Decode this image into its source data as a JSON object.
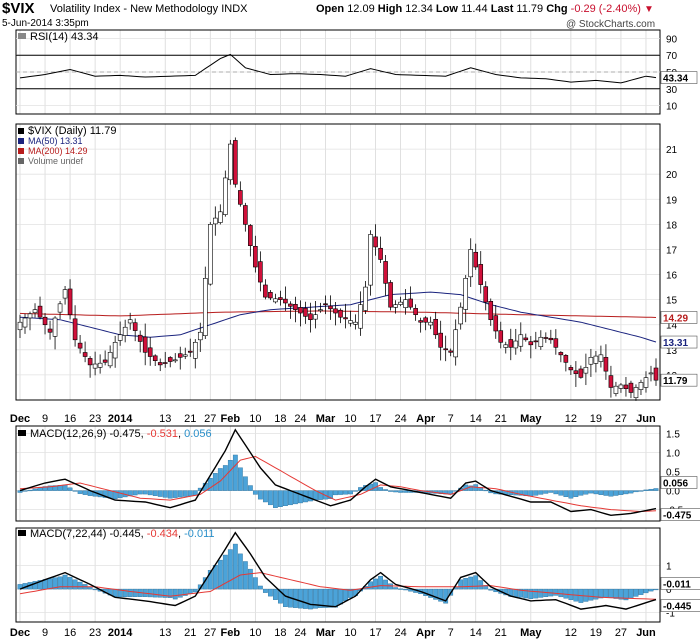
{
  "header": {
    "symbol": "$VIX",
    "name": "Volatility Index - New Methodology",
    "exchange": "INDX",
    "date": "5-Jun-2014 3:35pm",
    "open_label": "Open",
    "open": "12.09",
    "high_label": "High",
    "high": "12.34",
    "low_label": "Low",
    "low": "11.44",
    "last_label": "Last",
    "last": "11.79",
    "chg_label": "Chg",
    "chg": "-0.29 (-2.40%)",
    "watermark": "@ StockCharts.com"
  },
  "colors": {
    "up": "#ffffff",
    "down": "#d0103a",
    "ma50": "#1a237e",
    "ma200": "#b71c1c",
    "hist": "#4ba3d9",
    "signal": "#e53935"
  },
  "x_axis": {
    "labels": [
      {
        "text": "Dec",
        "i": 0,
        "bold": true
      },
      {
        "text": "9",
        "i": 5
      },
      {
        "text": "16",
        "i": 10
      },
      {
        "text": "23",
        "i": 15
      },
      {
        "text": "2014",
        "i": 20,
        "bold": true
      },
      {
        "text": "13",
        "i": 29
      },
      {
        "text": "21",
        "i": 34
      },
      {
        "text": "27",
        "i": 38
      },
      {
        "text": "Feb",
        "i": 42,
        "bold": true
      },
      {
        "text": "10",
        "i": 47
      },
      {
        "text": "18",
        "i": 52
      },
      {
        "text": "24",
        "i": 56
      },
      {
        "text": "Mar",
        "i": 61,
        "bold": true
      },
      {
        "text": "10",
        "i": 66
      },
      {
        "text": "17",
        "i": 71
      },
      {
        "text": "24",
        "i": 76
      },
      {
        "text": "Apr",
        "i": 81,
        "bold": true
      },
      {
        "text": "7",
        "i": 86
      },
      {
        "text": "14",
        "i": 91
      },
      {
        "text": "21",
        "i": 96
      },
      {
        "text": "May",
        "i": 102,
        "bold": true
      },
      {
        "text": "12",
        "i": 110
      },
      {
        "text": "19",
        "i": 115
      },
      {
        "text": "27",
        "i": 120
      },
      {
        "text": "Jun",
        "i": 125,
        "bold": true
      }
    ]
  },
  "rsi": {
    "legend": "RSI(14) 43.34",
    "last": "43.34",
    "ticks": [
      "90",
      "70",
      "50",
      "30",
      "10"
    ],
    "guides": [
      70,
      30
    ],
    "anchors": [
      [
        0,
        43
      ],
      [
        5,
        47
      ],
      [
        10,
        53
      ],
      [
        15,
        45
      ],
      [
        20,
        46
      ],
      [
        25,
        44
      ],
      [
        30,
        45
      ],
      [
        35,
        46
      ],
      [
        38,
        58
      ],
      [
        40,
        66
      ],
      [
        42,
        71
      ],
      [
        45,
        55
      ],
      [
        50,
        47
      ],
      [
        55,
        48
      ],
      [
        60,
        47
      ],
      [
        65,
        45
      ],
      [
        70,
        54
      ],
      [
        75,
        47
      ],
      [
        80,
        46
      ],
      [
        85,
        45
      ],
      [
        90,
        55
      ],
      [
        95,
        47
      ],
      [
        100,
        43
      ],
      [
        105,
        42
      ],
      [
        110,
        38
      ],
      [
        115,
        40
      ],
      [
        120,
        37
      ],
      [
        125,
        45
      ],
      [
        127,
        43.34
      ]
    ]
  },
  "chart_data": [
    {
      "type": "candlestick",
      "title": "$VIX (Daily) 11.79",
      "legend": [
        "$VIX (Daily) 11.79",
        "MA(50) 13.31",
        "MA(200) 14.29",
        "Volume undef"
      ],
      "ylim": [
        11,
        22
      ],
      "ticks": [
        "21",
        "20",
        "19",
        "18",
        "17",
        "16",
        "15",
        "14",
        "13",
        "12"
      ],
      "last_label": "11.79",
      "ma50_label": "13.31",
      "ma200_label": "14.29",
      "price_anchors": [
        [
          0,
          14.1
        ],
        [
          3,
          14.6
        ],
        [
          6,
          13.7
        ],
        [
          9,
          15.4
        ],
        [
          11,
          13.4
        ],
        [
          14,
          12.4
        ],
        [
          17,
          12.5
        ],
        [
          19,
          13.3
        ],
        [
          22,
          14.2
        ],
        [
          25,
          12.9
        ],
        [
          28,
          12.4
        ],
        [
          31,
          12.6
        ],
        [
          34,
          12.9
        ],
        [
          36,
          13.7
        ],
        [
          38,
          18.0
        ],
        [
          40,
          18.5
        ],
        [
          42,
          21.2
        ],
        [
          43,
          19.6
        ],
        [
          45,
          18.0
        ],
        [
          47,
          16.3
        ],
        [
          49,
          15.1
        ],
        [
          52,
          15.0
        ],
        [
          55,
          14.6
        ],
        [
          58,
          14.2
        ],
        [
          61,
          14.8
        ],
        [
          64,
          14.3
        ],
        [
          67,
          14.1
        ],
        [
          69,
          15.5
        ],
        [
          70,
          17.6
        ],
        [
          72,
          16.6
        ],
        [
          74,
          14.7
        ],
        [
          77,
          15.0
        ],
        [
          80,
          14.1
        ],
        [
          82,
          14.1
        ],
        [
          84,
          13.1
        ],
        [
          86,
          12.9
        ],
        [
          88,
          14.7
        ],
        [
          90,
          17.0
        ],
        [
          92,
          15.6
        ],
        [
          94,
          14.2
        ],
        [
          96,
          13.3
        ],
        [
          98,
          13.1
        ],
        [
          100,
          13.6
        ],
        [
          102,
          13.2
        ],
        [
          104,
          13.5
        ],
        [
          106,
          13.4
        ],
        [
          108,
          12.8
        ],
        [
          110,
          12.2
        ],
        [
          112,
          11.9
        ],
        [
          114,
          12.7
        ],
        [
          116,
          12.8
        ],
        [
          118,
          11.5
        ],
        [
          120,
          11.6
        ],
        [
          122,
          11.3
        ],
        [
          124,
          11.7
        ],
        [
          126,
          12.08
        ],
        [
          127,
          11.79
        ]
      ],
      "ma50_anchors": [
        [
          0,
          14.3
        ],
        [
          8,
          14.2
        ],
        [
          14,
          13.9
        ],
        [
          20,
          13.6
        ],
        [
          26,
          13.5
        ],
        [
          32,
          13.6
        ],
        [
          38,
          14.0
        ],
        [
          44,
          14.4
        ],
        [
          50,
          14.6
        ],
        [
          58,
          14.7
        ],
        [
          66,
          14.8
        ],
        [
          74,
          15.2
        ],
        [
          82,
          15.3
        ],
        [
          88,
          15.2
        ],
        [
          94,
          14.8
        ],
        [
          100,
          14.5
        ],
        [
          106,
          14.3
        ],
        [
          112,
          14.1
        ],
        [
          118,
          13.8
        ],
        [
          124,
          13.5
        ],
        [
          127,
          13.31
        ]
      ],
      "ma200_anchors": [
        [
          0,
          14.45
        ],
        [
          20,
          14.35
        ],
        [
          40,
          14.5
        ],
        [
          60,
          14.55
        ],
        [
          80,
          14.5
        ],
        [
          100,
          14.4
        ],
        [
          127,
          14.29
        ]
      ]
    },
    {
      "type": "area",
      "title": "MACD(12,26,9)",
      "legend_name": "MACD(12,26,9)",
      "macd": "-0.475",
      "signal": "-0.531",
      "hist": "0.056",
      "ylim": [
        -0.8,
        1.7
      ],
      "ticks": [
        "1.5",
        "1.0",
        "0.5",
        "0.0",
        "-0.5"
      ],
      "tick_values": [
        1.5,
        1.0,
        0.5,
        0.0,
        -0.5
      ],
      "last_hist_label": "0.056",
      "last_macd_label": "-0.475",
      "macd_anchors": [
        [
          0,
          0.0
        ],
        [
          5,
          0.2
        ],
        [
          9,
          0.3
        ],
        [
          14,
          0.0
        ],
        [
          19,
          -0.25
        ],
        [
          25,
          -0.3
        ],
        [
          30,
          -0.45
        ],
        [
          35,
          -0.25
        ],
        [
          38,
          0.4
        ],
        [
          41,
          1.05
        ],
        [
          43,
          1.6
        ],
        [
          45,
          1.2
        ],
        [
          48,
          0.6
        ],
        [
          51,
          0.15
        ],
        [
          54,
          0.0
        ],
        [
          58,
          -0.2
        ],
        [
          62,
          -0.4
        ],
        [
          66,
          -0.25
        ],
        [
          69,
          0.1
        ],
        [
          71,
          0.3
        ],
        [
          74,
          0.1
        ],
        [
          78,
          0.0
        ],
        [
          82,
          -0.1
        ],
        [
          86,
          -0.2
        ],
        [
          89,
          0.2
        ],
        [
          91,
          0.25
        ],
        [
          94,
          0.0
        ],
        [
          98,
          -0.15
        ],
        [
          102,
          -0.3
        ],
        [
          106,
          -0.3
        ],
        [
          110,
          -0.55
        ],
        [
          114,
          -0.5
        ],
        [
          118,
          -0.65
        ],
        [
          122,
          -0.6
        ],
        [
          127,
          -0.475
        ]
      ],
      "signal_anchors": [
        [
          0,
          0.05
        ],
        [
          6,
          0.1
        ],
        [
          12,
          0.2
        ],
        [
          18,
          0.0
        ],
        [
          24,
          -0.2
        ],
        [
          30,
          -0.25
        ],
        [
          36,
          -0.1
        ],
        [
          40,
          0.25
        ],
        [
          44,
          0.8
        ],
        [
          47,
          0.9
        ],
        [
          51,
          0.6
        ],
        [
          55,
          0.3
        ],
        [
          59,
          0.0
        ],
        [
          63,
          -0.25
        ],
        [
          68,
          -0.1
        ],
        [
          72,
          0.15
        ],
        [
          76,
          0.1
        ],
        [
          80,
          0.0
        ],
        [
          86,
          -0.1
        ],
        [
          90,
          0.1
        ],
        [
          95,
          0.05
        ],
        [
          100,
          -0.1
        ],
        [
          106,
          -0.25
        ],
        [
          112,
          -0.4
        ],
        [
          118,
          -0.5
        ],
        [
          124,
          -0.55
        ],
        [
          127,
          -0.531
        ]
      ]
    },
    {
      "type": "area",
      "title": "MACD(7,22,44)",
      "legend_name": "MACD(7,22,44)",
      "macd": "-0.445",
      "signal": "-0.434",
      "hist": "-0.011",
      "ylim": [
        -1.4,
        2.6
      ],
      "ticks": [
        "1",
        "0",
        "-1"
      ],
      "tick_values": [
        1,
        0,
        -1
      ],
      "last_hist_label": "-0.011",
      "last_macd_label": "-0.445",
      "macd_anchors": [
        [
          0,
          0.0
        ],
        [
          5,
          0.4
        ],
        [
          9,
          0.7
        ],
        [
          14,
          0.2
        ],
        [
          19,
          -0.35
        ],
        [
          25,
          -0.5
        ],
        [
          31,
          -0.7
        ],
        [
          35,
          -0.3
        ],
        [
          38,
          0.7
        ],
        [
          41,
          1.7
        ],
        [
          43,
          2.4
        ],
        [
          46,
          1.5
        ],
        [
          49,
          0.5
        ],
        [
          53,
          -0.3
        ],
        [
          58,
          -0.65
        ],
        [
          63,
          -0.75
        ],
        [
          67,
          -0.3
        ],
        [
          70,
          0.4
        ],
        [
          72,
          0.7
        ],
        [
          75,
          0.2
        ],
        [
          80,
          -0.1
        ],
        [
          85,
          -0.5
        ],
        [
          88,
          0.5
        ],
        [
          91,
          0.7
        ],
        [
          94,
          0.1
        ],
        [
          98,
          -0.3
        ],
        [
          102,
          -0.5
        ],
        [
          107,
          -0.45
        ],
        [
          112,
          -0.85
        ],
        [
          117,
          -0.7
        ],
        [
          121,
          -0.85
        ],
        [
          127,
          -0.445
        ]
      ],
      "signal_anchors": [
        [
          0,
          -0.2
        ],
        [
          8,
          0.1
        ],
        [
          15,
          0.1
        ],
        [
          22,
          -0.1
        ],
        [
          30,
          -0.3
        ],
        [
          38,
          -0.1
        ],
        [
          44,
          0.6
        ],
        [
          48,
          0.7
        ],
        [
          54,
          0.4
        ],
        [
          60,
          0.1
        ],
        [
          66,
          -0.05
        ],
        [
          72,
          0.15
        ],
        [
          80,
          0.1
        ],
        [
          88,
          0.1
        ],
        [
          94,
          0.15
        ],
        [
          100,
          -0.05
        ],
        [
          108,
          -0.2
        ],
        [
          116,
          -0.35
        ],
        [
          127,
          -0.434
        ]
      ]
    }
  ]
}
